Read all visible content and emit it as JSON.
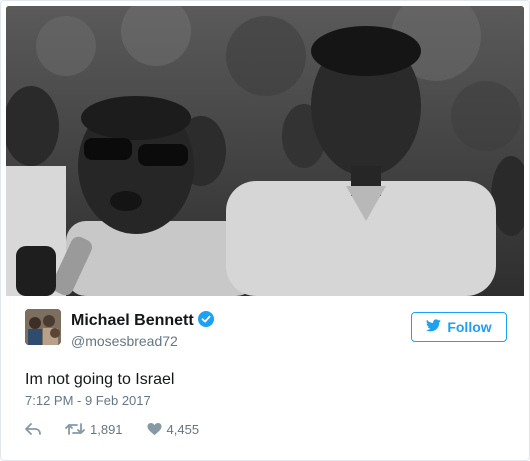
{
  "tweet": {
    "author_name": "Michael Bennett",
    "handle": "@mosesbread72",
    "follow_label": "Follow",
    "text": "Im not going to Israel",
    "timestamp": "7:12 PM - 9 Feb 2017",
    "retweets": "1,891",
    "likes": "4,455"
  },
  "icons": {
    "verified": "verified-badge-icon",
    "follow": "twitter-bird-icon",
    "reply": "reply-icon",
    "retweet": "retweet-icon",
    "like": "heart-icon"
  },
  "colors": {
    "accent": "#1da1f2",
    "text": "#14171a",
    "muted": "#657786",
    "border": "#e1e8ed"
  }
}
